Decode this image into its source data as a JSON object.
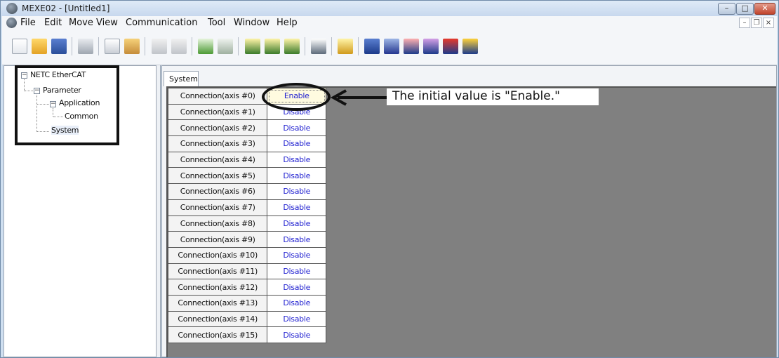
{
  "window": {
    "title": "MEXE02 - [Untitled1]",
    "controls": {
      "minimize": "–",
      "maximize": "□",
      "close": "✕"
    }
  },
  "menu": {
    "items": [
      "File",
      "Edit",
      "Move",
      "View",
      "Communication",
      "Tool",
      "Window",
      "Help"
    ],
    "mdi": {
      "minimize": "–",
      "restore": "❐",
      "close": "×"
    }
  },
  "toolbar": {
    "buttons": [
      "new-icon",
      "open-icon",
      "save-icon",
      "print-icon",
      "copy-icon",
      "paste-icon",
      "undo-icon",
      "redo-icon",
      "compare-icon",
      "compare-all-icon",
      "read-icon",
      "write-icon",
      "verify-icon",
      "teach-icon",
      "help-icon",
      "rs485-icon",
      "io-icon",
      "register-icon",
      "monitor-icon",
      "info-icon",
      "info2-icon"
    ]
  },
  "tree": {
    "root": "NETC EtherCAT",
    "parameter": "Parameter",
    "application": "Application",
    "common": "Common",
    "system": "System",
    "expander": "−"
  },
  "tab": {
    "label": "System"
  },
  "table": {
    "rows": [
      {
        "label": "Connection(axis #0)",
        "value": "Enable"
      },
      {
        "label": "Connection(axis #1)",
        "value": "Disable"
      },
      {
        "label": "Connection(axis #2)",
        "value": "Disable"
      },
      {
        "label": "Connection(axis #3)",
        "value": "Disable"
      },
      {
        "label": "Connection(axis #4)",
        "value": "Disable"
      },
      {
        "label": "Connection(axis #5)",
        "value": "Disable"
      },
      {
        "label": "Connection(axis #6)",
        "value": "Disable"
      },
      {
        "label": "Connection(axis #7)",
        "value": "Disable"
      },
      {
        "label": "Connection(axis #8)",
        "value": "Disable"
      },
      {
        "label": "Connection(axis #9)",
        "value": "Disable"
      },
      {
        "label": "Connection(axis #10)",
        "value": "Disable"
      },
      {
        "label": "Connection(axis #11)",
        "value": "Disable"
      },
      {
        "label": "Connection(axis #12)",
        "value": "Disable"
      },
      {
        "label": "Connection(axis #13)",
        "value": "Disable"
      },
      {
        "label": "Connection(axis #14)",
        "value": "Disable"
      },
      {
        "label": "Connection(axis #15)",
        "value": "Disable"
      }
    ]
  },
  "annotation": {
    "callout": "The initial value is \"Enable.\""
  },
  "colors": {
    "value_text": "#1f1fd0",
    "grid_bg": "#808080",
    "accent": "#c1432c"
  }
}
